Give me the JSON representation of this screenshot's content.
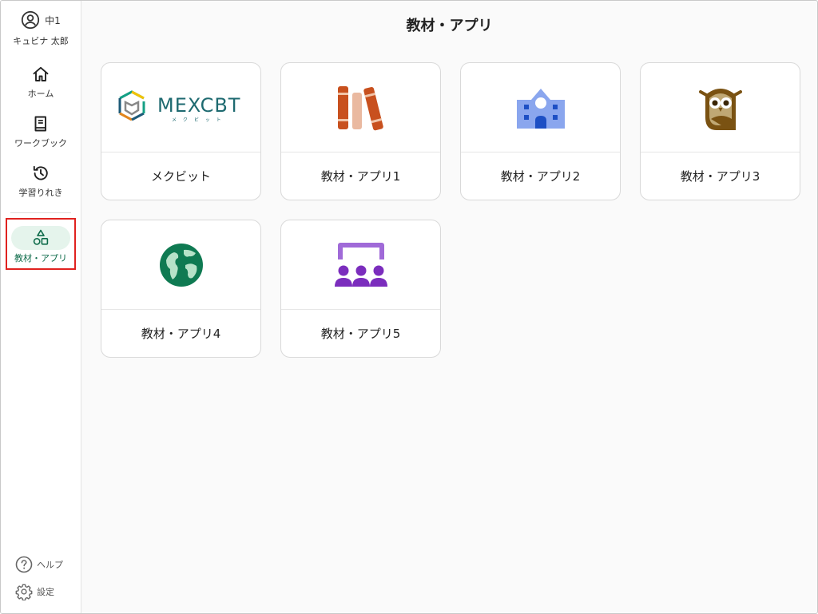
{
  "user": {
    "grade": "中1",
    "name": "キュビナ 太郎"
  },
  "nav": {
    "home": "ホーム",
    "workbook": "ワークブック",
    "history": "学習りれき",
    "materials": "教材・アプリ"
  },
  "bottom": {
    "help": "ヘルプ",
    "settings": "設定"
  },
  "page": {
    "title": "教材・アプリ"
  },
  "mexcbt": {
    "logo_text": "MEXCBT",
    "logo_sub": "メ ク ビ ッ ト"
  },
  "cards": [
    {
      "label": "メクビット",
      "icon": "mexcbt-logo"
    },
    {
      "label": "教材・アプリ1",
      "icon": "books-icon"
    },
    {
      "label": "教材・アプリ2",
      "icon": "school-icon"
    },
    {
      "label": "教材・アプリ3",
      "icon": "owl-icon"
    },
    {
      "label": "教材・アプリ4",
      "icon": "globe-icon"
    },
    {
      "label": "教材・アプリ5",
      "icon": "classroom-icon"
    }
  ],
  "colors": {
    "accent_green": "#0e6b4a",
    "active_bg": "#e5f4ec",
    "highlight_red": "#e0221f",
    "books": "#c8501e",
    "school": "#8aa6ee",
    "owl": "#7a5212",
    "globe": "#0f7a52",
    "classroom": "#7b2dbd"
  }
}
